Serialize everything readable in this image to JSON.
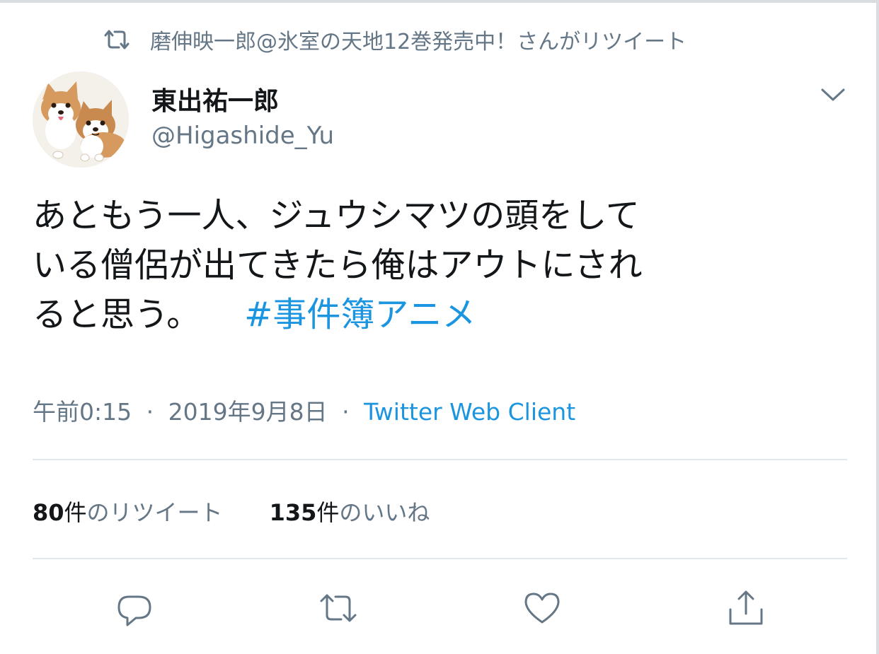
{
  "retweet_context": {
    "icon": "retweet-icon",
    "text": "磨伸映一郎@氷室の天地12巻発売中！さんがリツイート"
  },
  "author": {
    "name": "東出祐一郎",
    "handle": "@Higashide_Yu",
    "avatar": "avatar-corgi-dogs"
  },
  "tweet": {
    "lines": [
      "あともう一人、ジュウシマツの頭をして",
      "いる僧侶が出てきたら俺はアウトにされ",
      "ると思う。"
    ],
    "hashtag": "#事件簿アニメ"
  },
  "meta": {
    "time": "午前0:15",
    "separator": "·",
    "date": "2019年9月8日",
    "client": "Twitter Web Client"
  },
  "stats": {
    "retweets": {
      "count": "80",
      "unit": "件",
      "label": "のリツイート"
    },
    "likes": {
      "count": "135",
      "unit": "件",
      "label": "のいいね"
    }
  },
  "actions": [
    "reply-icon",
    "retweet-icon",
    "like-icon",
    "share-icon"
  ],
  "colors": {
    "link": "#1b95e0",
    "secondary_text": "#657786",
    "primary_text": "#14171a",
    "divider": "#e1e8ed",
    "icon": "#657786"
  }
}
